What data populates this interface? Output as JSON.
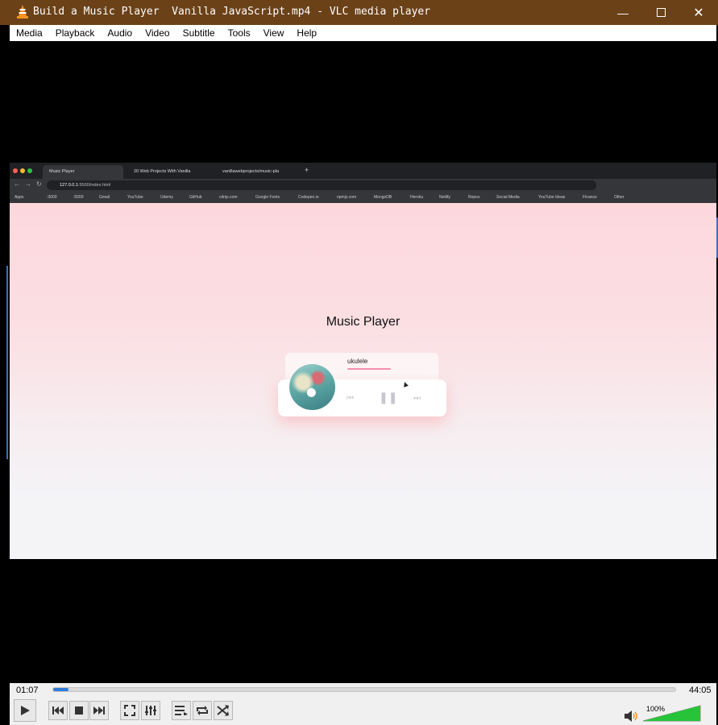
{
  "window": {
    "title": "Build a Music Player  Vanilla JavaScript.mp4 - VLC media player",
    "minimize_icon": "minimize-icon",
    "maximize_icon": "maximize-icon",
    "close_icon": "close-icon"
  },
  "menu": [
    "Media",
    "Playback",
    "Audio",
    "Video",
    "Subtitle",
    "Tools",
    "View",
    "Help"
  ],
  "browser": {
    "tabs": [
      "Music Player",
      "20 Web Projects With Vanilla",
      "vanillawebprojects/music-pla"
    ],
    "url_host": "127.0.0.1",
    "url_rest": ":5500/index.html",
    "bookmarks": [
      "Apps",
      ":3000",
      ":5000",
      "Gmail",
      "YouTube",
      "Udemy",
      "GitHub",
      "cdnjs.com",
      "Google Fonts",
      "Codepen.io",
      "npmjs.com",
      "MongoDB",
      "Heroku",
      "Netlify",
      "Repos",
      "Social Media",
      "YouTube Ideas",
      "Finance",
      "Other"
    ]
  },
  "music_player": {
    "title": "Music Player",
    "song": "ukulele"
  },
  "playback": {
    "current_time": "01:07",
    "total_time": "44:05",
    "progress_fraction": 0.025,
    "volume_label": "100%",
    "volume_fraction": 1.0
  },
  "colors": {
    "title_bar": "#6b4118",
    "seek_fill": "#2f7bd5",
    "volume_green": "#27c43a"
  }
}
